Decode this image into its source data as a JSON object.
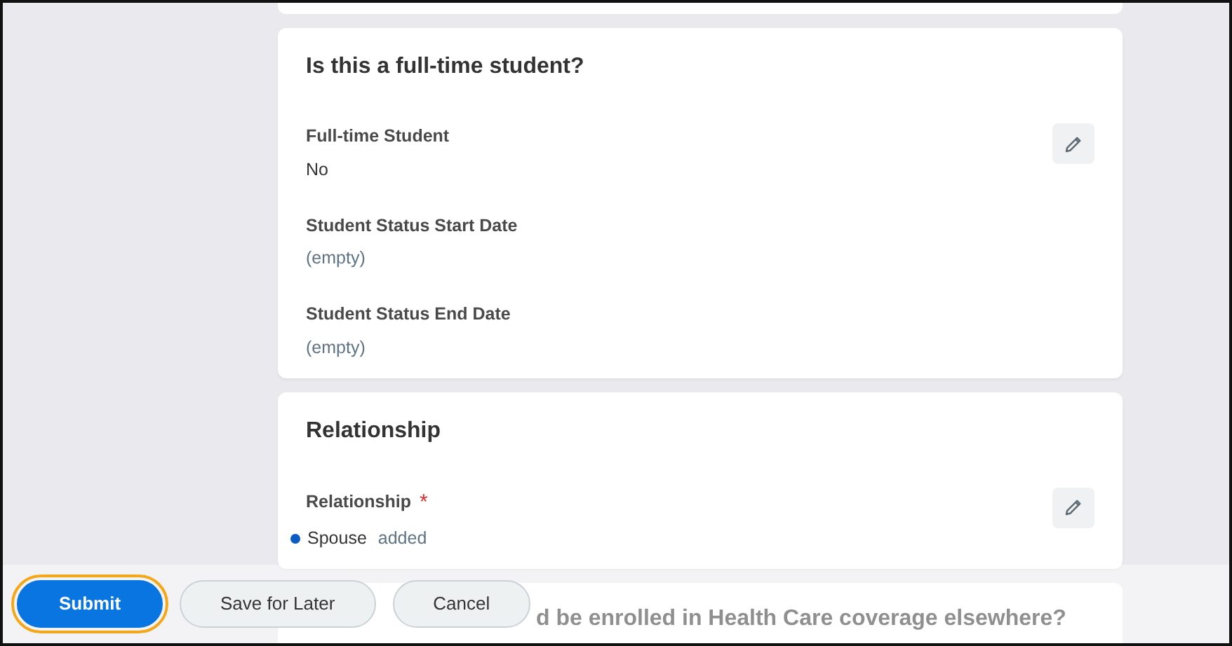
{
  "sections": [
    {
      "title": "Is this a full-time student?",
      "fields": [
        {
          "label": "Full-time Student",
          "required": false,
          "value": "No",
          "empty": false
        },
        {
          "label": "Student Status Start Date",
          "required": false,
          "value": "(empty)",
          "empty": true
        },
        {
          "label": "Student Status End Date",
          "required": false,
          "value": "(empty)",
          "empty": true
        }
      ]
    },
    {
      "title": "Relationship",
      "fields": [
        {
          "label": "Relationship",
          "required": true,
          "required_mark": "*",
          "value": "Spouse",
          "change": "added",
          "color": "#0b5cc4",
          "empty": false
        }
      ]
    }
  ],
  "covered_section": {
    "title_fragment": "d be enrolled in Health Care coverage elsewhere?"
  },
  "footer": {
    "buttons": [
      {
        "label": "Submit",
        "kind": "primary",
        "focused": true
      },
      {
        "label": "Save for Later",
        "kind": "secondary",
        "focused": false
      },
      {
        "label": "Cancel",
        "kind": "secondary",
        "focused": false
      }
    ]
  }
}
